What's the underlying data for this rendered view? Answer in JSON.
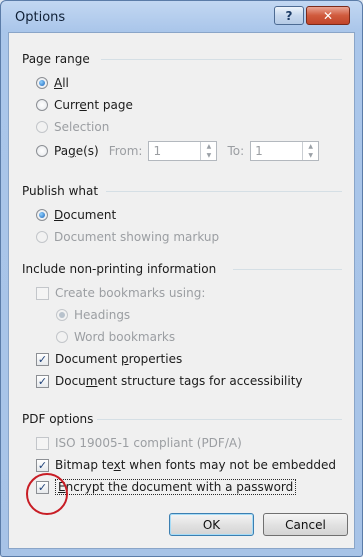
{
  "window": {
    "title": "Options",
    "help_label": "?",
    "close_label": "✕"
  },
  "page_range": {
    "title": "Page range",
    "all": {
      "pre": "",
      "accel": "A",
      "post": "ll",
      "checked": true
    },
    "current": {
      "pre": "Curr",
      "accel": "e",
      "post": "nt page",
      "checked": false
    },
    "selection": {
      "label": "Selection",
      "disabled": true
    },
    "pages": {
      "pre": "Pa",
      "accel": "g",
      "post": "e(s)",
      "checked": false
    },
    "from_label": "From:",
    "from_value": "1",
    "to_label": "To:",
    "to_value": "1"
  },
  "publish_what": {
    "title": "Publish what",
    "document": {
      "pre": "",
      "accel": "D",
      "post": "ocument",
      "checked": true
    },
    "markup": {
      "label": "Document showing markup",
      "disabled": true
    }
  },
  "non_printing": {
    "title": "Include non-printing information",
    "bookmarks": {
      "label": "Create bookmarks using:",
      "checked": false,
      "disabled": true
    },
    "headings": {
      "label": "Headings",
      "checked": true,
      "disabled": true
    },
    "word_bookmarks": {
      "label": "Word bookmarks",
      "disabled": true
    },
    "doc_props": {
      "pre": "Document ",
      "accel": "p",
      "post": "roperties",
      "checked": true
    },
    "struct_tags": {
      "pre": "Docu",
      "accel": "m",
      "post": "ent structure tags for accessibility",
      "checked": true
    }
  },
  "pdf_options": {
    "title": "PDF options",
    "iso": {
      "label": "ISO 19005-1 compliant (PDF/A)",
      "checked": false,
      "disabled": true
    },
    "bitmap": {
      "pre": "Bitmap te",
      "accel": "x",
      "post": "t when fonts may not be embedded",
      "checked": true
    },
    "encrypt": {
      "pre": "",
      "accel": "E",
      "post": "ncrypt the document with a password",
      "checked": true
    }
  },
  "buttons": {
    "ok": "OK",
    "cancel": "Cancel"
  },
  "check_glyph": "✓"
}
